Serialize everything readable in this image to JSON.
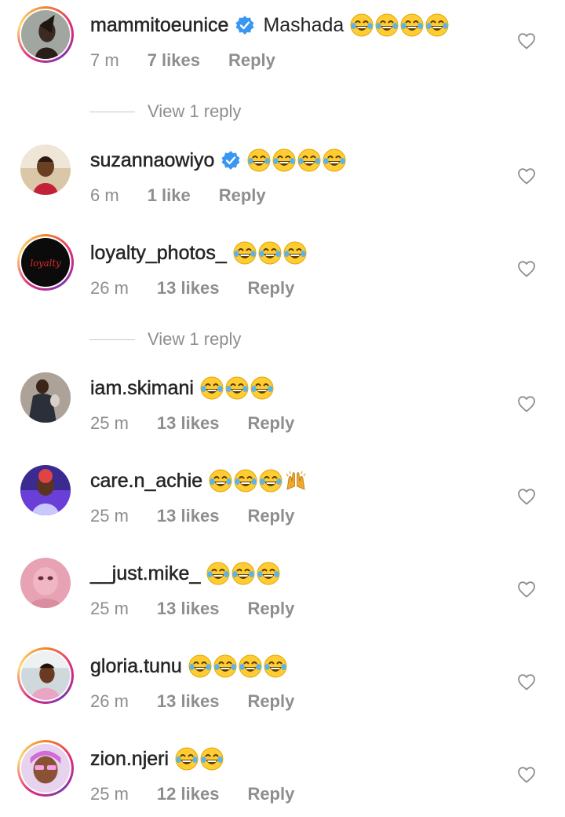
{
  "comments": [
    {
      "username": "mammitoeunice",
      "verified": true,
      "text": "Mashada",
      "emoji_count": 4,
      "emojis": [
        "tears-of-joy-emoji",
        "tears-of-joy-emoji",
        "tears-of-joy-emoji",
        "tears-of-joy-emoji"
      ],
      "time": "7 m",
      "likes": "7 likes",
      "reply": "Reply",
      "story_ring": true
    },
    {
      "username": "suzannaowiyo",
      "verified": true,
      "text": "",
      "emojis": [
        "tears-of-joy-emoji",
        "tears-of-joy-emoji",
        "tears-of-joy-emoji",
        "tears-of-joy-emoji"
      ],
      "time": "6 m",
      "likes": "1 like",
      "reply": "Reply",
      "story_ring": false
    },
    {
      "username": "loyalty_photos_",
      "verified": false,
      "text": "",
      "emojis": [
        "tears-of-joy-emoji",
        "tears-of-joy-emoji",
        "tears-of-joy-emoji"
      ],
      "time": "26 m",
      "likes": "13 likes",
      "reply": "Reply",
      "story_ring": true,
      "avatar_text": "loyalty"
    },
    {
      "username": "iam.skimani",
      "verified": false,
      "text": "",
      "emojis": [
        "tears-of-joy-emoji",
        "tears-of-joy-emoji",
        "tears-of-joy-emoji"
      ],
      "time": "25 m",
      "likes": "13 likes",
      "reply": "Reply",
      "story_ring": false
    },
    {
      "username": "care.n_achie",
      "verified": false,
      "text": "",
      "emojis": [
        "tears-of-joy-emoji",
        "tears-of-joy-emoji",
        "tears-of-joy-emoji",
        "raising-hands-emoji"
      ],
      "time": "25 m",
      "likes": "13 likes",
      "reply": "Reply",
      "story_ring": false
    },
    {
      "username": "__just.mike_",
      "verified": false,
      "text": "",
      "emojis": [
        "tears-of-joy-emoji",
        "tears-of-joy-emoji",
        "tears-of-joy-emoji"
      ],
      "time": "25 m",
      "likes": "13 likes",
      "reply": "Reply",
      "story_ring": false
    },
    {
      "username": "gloria.tunu",
      "verified": false,
      "text": "",
      "emojis": [
        "tears-of-joy-emoji",
        "tears-of-joy-emoji",
        "tears-of-joy-emoji",
        "tears-of-joy-emoji"
      ],
      "time": "26 m",
      "likes": "13 likes",
      "reply": "Reply",
      "story_ring": true
    },
    {
      "username": "zion.njeri",
      "verified": false,
      "text": "",
      "emojis": [
        "tears-of-joy-emoji",
        "tears-of-joy-emoji"
      ],
      "time": "25 m",
      "likes": "12 likes",
      "reply": "Reply",
      "story_ring": true
    }
  ],
  "view_replies": [
    {
      "label": "View 1 reply"
    },
    {
      "label": "View 1 reply"
    }
  ],
  "colors": {
    "text": "#262626",
    "meta": "#8e8e8e",
    "verified_blue": "#3897f0",
    "divider": "#c7c7c7"
  },
  "icons": {
    "like": "heart-outline-icon",
    "verified": "verified-badge-icon"
  }
}
